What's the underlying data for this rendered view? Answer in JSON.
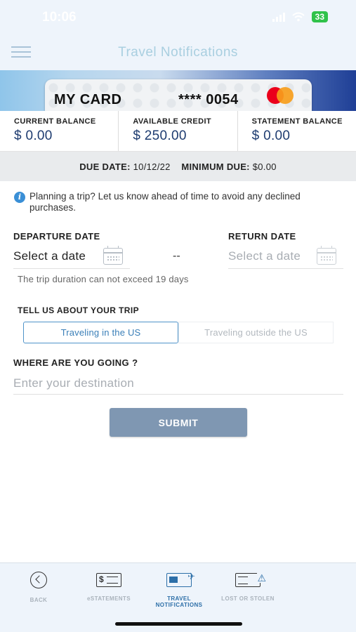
{
  "status_bar": {
    "time": "10:06",
    "battery": "33"
  },
  "header": {
    "title": "Travel Notifications",
    "menu_icon": "hamburger-menu-icon"
  },
  "card": {
    "name": "MY CARD",
    "number": "**** 0054",
    "brand_icon": "mastercard-logo"
  },
  "balances": [
    {
      "label": "CURRENT BALANCE",
      "value": "$ 0.00"
    },
    {
      "label": "AVAILABLE CREDIT",
      "value": "$ 250.00"
    },
    {
      "label": "STATEMENT BALANCE",
      "value": "$ 0.00"
    }
  ],
  "due": {
    "due_label": "DUE DATE:",
    "due_value": "10/12/22",
    "min_label": "MINIMUM DUE:",
    "min_value": "$0.00"
  },
  "info": {
    "icon": "info-icon",
    "text": "Planning a trip? Let us know ahead of time to avoid any declined purchases."
  },
  "departure": {
    "label": "DEPARTURE DATE",
    "value": "Select a date"
  },
  "separator": "--",
  "return": {
    "label": "RETURN DATE",
    "value": "Select a date"
  },
  "hint": "The trip duration can not exceed 19 days",
  "trip": {
    "label": "TELL US ABOUT YOUR TRIP",
    "options": [
      "Traveling in the US",
      "Traveling outside the US"
    ],
    "selected": "Traveling in the US"
  },
  "destination": {
    "label": "WHERE ARE YOU GOING ?",
    "placeholder": "Enter your destination",
    "value": ""
  },
  "submit_label": "SUBMIT",
  "bottom_nav": [
    {
      "label": "BACK",
      "icon": "back-icon"
    },
    {
      "label": "eSTATEMENTS",
      "icon": "statement-icon"
    },
    {
      "label": "TRAVEL NOTIFICATIONS",
      "icon": "travel-icon",
      "active": true
    },
    {
      "label": "LOST OR STOLEN",
      "icon": "lost-card-icon"
    }
  ],
  "colors": {
    "accent": "#2d6fa8",
    "navy": "#1e3c70",
    "submit_bg": "#7f97b2",
    "header_bg": "#eef4fb"
  }
}
